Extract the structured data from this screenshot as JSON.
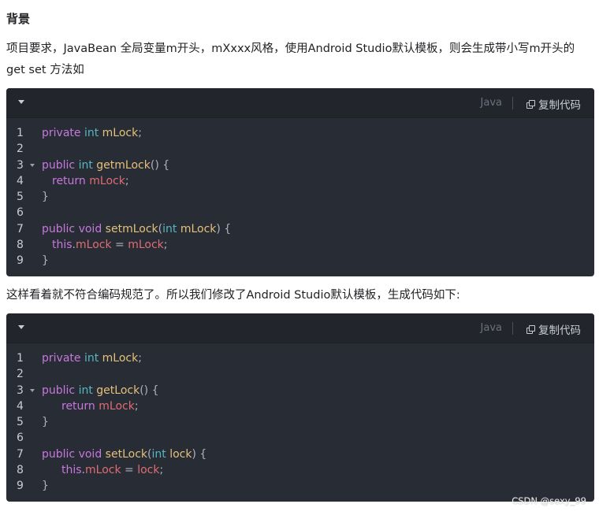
{
  "article": {
    "heading": "背景",
    "para1_line1": "项目要求，JavaBean 全局变量m开头，mXxxx风格，使用Android Studio默认模板，则会生成带小写m开头的",
    "para1_line2": "get   set 方法如",
    "para2": "这样看着就不符合编码规范了。所以我们修改了Android Studio默认模板，生成代码如下:"
  },
  "code_blocks": [
    {
      "language": "Java",
      "copy_label": "复制代码",
      "lines": [
        {
          "n": "1",
          "t": {
            "a": "private",
            "b": " ",
            "c": "int",
            "d": " ",
            "e": "mLock",
            "f": ";"
          }
        },
        {
          "n": "2"
        },
        {
          "n": "3",
          "t": {
            "a": "public",
            "b": " ",
            "c": "int",
            "d": " ",
            "e": "getmLock",
            "f": "() {"
          }
        },
        {
          "n": "4",
          "t": {
            "a": "return",
            "b": " ",
            "e": "mLock",
            "f": ";"
          }
        },
        {
          "n": "5",
          "t": {
            "f": "}"
          }
        },
        {
          "n": "6"
        },
        {
          "n": "7",
          "t": {
            "a": "public",
            "b": " ",
            "c": "void",
            "d": " ",
            "e": "setmLock",
            "f": "(",
            "g": "int",
            "h": " ",
            "i": "mLock",
            "j": ") {"
          }
        },
        {
          "n": "8",
          "t": {
            "a": "this",
            "f": ".",
            "e": "mLock",
            "g": " = ",
            "i": "mLock",
            "j": ";"
          }
        },
        {
          "n": "9",
          "t": {
            "f": "}"
          }
        }
      ]
    },
    {
      "language": "Java",
      "copy_label": "复制代码",
      "lines": [
        {
          "n": "1"
        },
        {
          "n": "2"
        },
        {
          "n": "3"
        },
        {
          "n": "4"
        },
        {
          "n": "5"
        },
        {
          "n": "6"
        },
        {
          "n": "7"
        },
        {
          "n": "8"
        },
        {
          "n": "9"
        }
      ]
    }
  ],
  "watermark": "CSDN @sexy_99",
  "colors": {
    "keyword": "#c678dd",
    "type": "#56b6c2",
    "function": "#e5c07b",
    "variable": "#e06c75",
    "background": "#282c34"
  }
}
